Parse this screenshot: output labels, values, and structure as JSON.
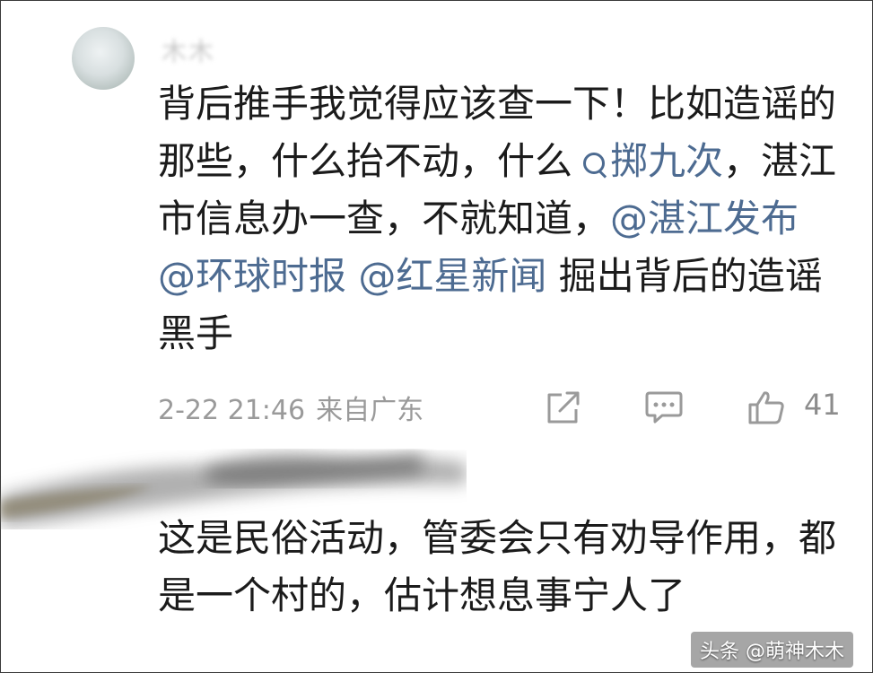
{
  "comment1": {
    "username": "木木",
    "text_part1": "背后推手我觉得应该查一下！比如造谣的那些，什么抬不动，什么",
    "search_link": "掷九次",
    "text_part2": "，湛江市信息办一查，不就知道，",
    "mention1": "@湛江发布",
    "mention2": "@环球时报",
    "mention3": "@红星新闻",
    "text_part3": "掘出背后的造谣黑手",
    "timestamp": "2-22 21:46",
    "location": "来自广东",
    "like_count": "41"
  },
  "comment2": {
    "text": "这是民俗活动，管委会只有劝导作用，都是一个村的，估计想息事宁人了"
  },
  "watermark": "头条 @萌神木木",
  "colors": {
    "link": "#4d6b91",
    "meta": "#9a9a9a",
    "text": "#1b1b1b"
  },
  "icons": [
    "share-icon",
    "comment-icon",
    "like-icon",
    "search-icon"
  ]
}
